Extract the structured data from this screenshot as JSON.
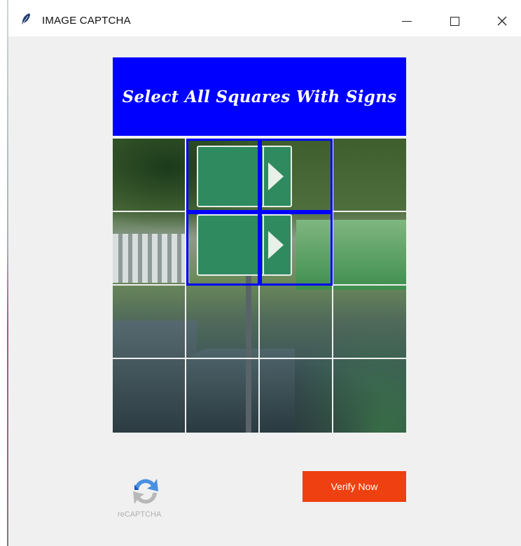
{
  "window": {
    "title": "IMAGE CAPTCHA",
    "app_icon": "feather-icon",
    "controls": [
      "minimize-icon",
      "maximize-icon",
      "close-icon"
    ]
  },
  "captcha": {
    "instruction": "Select All Squares With Signs",
    "banner_color": "#0000ff",
    "grid": {
      "rows": 4,
      "columns": 4,
      "selected_tiles": [
        [
          0,
          1
        ],
        [
          0,
          2
        ],
        [
          1,
          1
        ],
        [
          1,
          2
        ]
      ],
      "selection_color": "#0000ff"
    }
  },
  "footer": {
    "recaptcha_label": "reCAPTCHA",
    "verify_label": "Verify Now",
    "verify_color": "#ee4010"
  }
}
